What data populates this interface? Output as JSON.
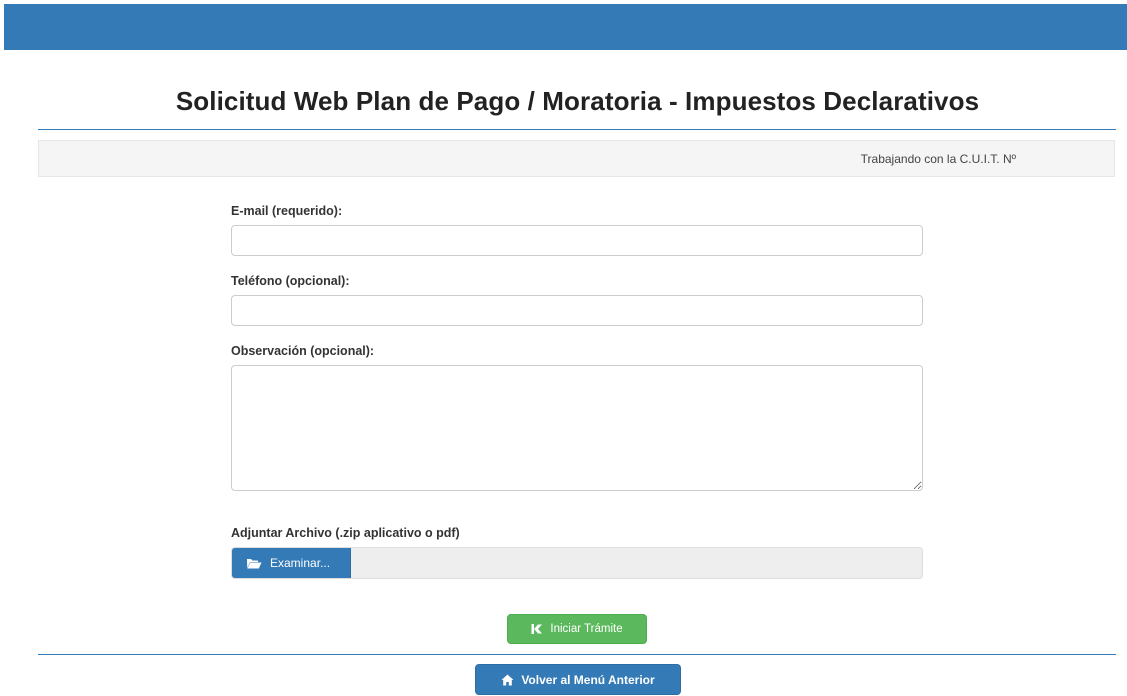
{
  "header": {
    "title": "Solicitud Web Plan de Pago / Moratoria - Impuestos Declarativos",
    "bar_color": "#337ab7"
  },
  "cuit_bar": {
    "text": "Trabajando con la C.U.I.T. Nº"
  },
  "form": {
    "email_label": "E-mail (requerido):",
    "email_value": "",
    "phone_label": "Teléfono (opcional):",
    "phone_value": "",
    "observation_label": "Observación (opcional):",
    "observation_value": "",
    "attach_label": "Adjuntar Archivo (.zip aplicativo o pdf)",
    "browse_label": "Examinar...",
    "browse_icon": "folder-open-icon"
  },
  "actions": {
    "start_label": "Iniciar Trámite",
    "start_icon": "start-process-icon",
    "start_color": "#5cb85c",
    "back_label": "Volver al Menú Anterior",
    "back_icon": "home-icon",
    "back_color": "#337ab7"
  }
}
